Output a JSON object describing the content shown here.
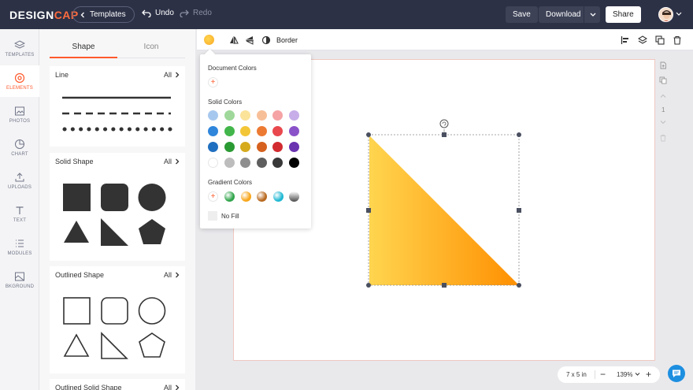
{
  "topbar": {
    "logo_main": "DESIGN",
    "logo_accent": "CAP",
    "templates_label": "Templates",
    "undo_label": "Undo",
    "redo_label": "Redo",
    "save_label": "Save",
    "download_label": "Download",
    "share_label": "Share"
  },
  "rail": {
    "items": [
      {
        "label": "TEMPLATES",
        "icon": "layers-icon"
      },
      {
        "label": "ELEMENTS",
        "icon": "elements-icon"
      },
      {
        "label": "PHOTOS",
        "icon": "image-icon"
      },
      {
        "label": "CHART",
        "icon": "pie-chart-icon"
      },
      {
        "label": "UPLOADS",
        "icon": "upload-icon"
      },
      {
        "label": "TEXT",
        "icon": "text-icon"
      },
      {
        "label": "MODULES",
        "icon": "list-icon"
      },
      {
        "label": "BKGROUND",
        "icon": "background-icon"
      }
    ]
  },
  "panel": {
    "tabs": [
      "Shape",
      "Icon"
    ],
    "all_label": "All",
    "sections": {
      "line": "Line",
      "solid": "Solid Shape",
      "outlined": "Outlined Shape",
      "outlined_solid": "Outlined Solid Shape"
    }
  },
  "toolbar": {
    "border_label": "Border",
    "fill_color": "#f9a825"
  },
  "color_popup": {
    "document_colors_label": "Document Colors",
    "solid_colors_label": "Solid Colors",
    "gradient_colors_label": "Gradient Colors",
    "no_fill_label": "No Fill",
    "add_symbol": "+",
    "solid_colors": [
      [
        "#a7c8ee",
        "#9fd89a",
        "#fbe39a",
        "#f7bf98",
        "#f5a3a4",
        "#c7aee8"
      ],
      [
        "#2f86db",
        "#42b64a",
        "#f3c637",
        "#ec7a33",
        "#e9484d",
        "#8a52c8"
      ],
      [
        "#1f6fc0",
        "#2a9a33",
        "#d6aa1d",
        "#d6611e",
        "#d12b30",
        "#6a33b0"
      ],
      [
        "#ffffff",
        "#bdbdbd",
        "#8f8f8f",
        "#5e5e5e",
        "#383838",
        "#000000"
      ]
    ],
    "gradient_colors": [
      "#2fa44a",
      "#f7a61a",
      "#b8691f",
      "#1fb8d3",
      "#4a4a4a"
    ]
  },
  "canvas": {
    "shape_gradient_start": "#ffd54f",
    "shape_gradient_end": "#ff8f00"
  },
  "side_tools": {
    "page_number": "1"
  },
  "zoombar": {
    "size_label": "7 x 5 in",
    "minus": "−",
    "zoom": "139%",
    "plus": "+"
  }
}
